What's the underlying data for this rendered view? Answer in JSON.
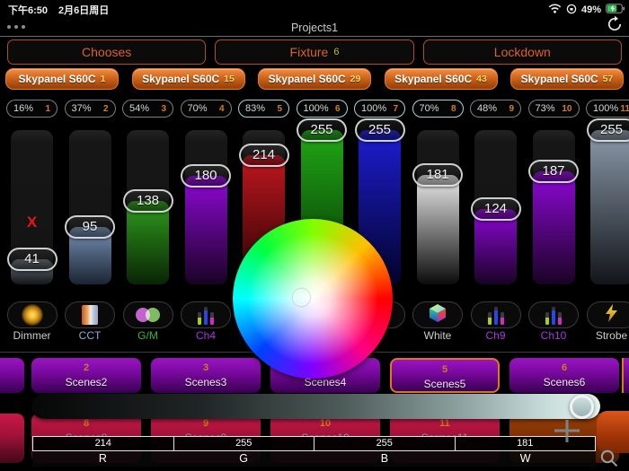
{
  "status_bar": {
    "time": "下午6:50",
    "date": "2月6日周日",
    "battery": "49%"
  },
  "nav": {
    "title": "Projects1"
  },
  "icons": [
    "page-dots",
    "wifi",
    "orientation-lock",
    "battery-charging",
    "refresh",
    "plus",
    "magnifier"
  ],
  "toolbar": {
    "buttons": [
      {
        "label": "Chooses",
        "badge": ""
      },
      {
        "label": "Fixture",
        "badge": "6"
      },
      {
        "label": "Lockdown",
        "badge": ""
      }
    ]
  },
  "fixture_tabs": [
    {
      "name": "Skypanel S60C",
      "num": "1"
    },
    {
      "name": "Skypanel S60C",
      "num": "15"
    },
    {
      "name": "Skypanel S60C",
      "num": "29"
    },
    {
      "name": "Skypanel S60C",
      "num": "43"
    },
    {
      "name": "Skypanel S60C",
      "num": "57"
    }
  ],
  "channels": [
    {
      "percent": "16%",
      "num": "1",
      "value": "41",
      "highlighted": false,
      "label": "Dimmer",
      "label_color": "#cccccc",
      "icon": "dimmer",
      "fill_top": "#68727c",
      "fill_bottom": "#14171a",
      "x_mark": true
    },
    {
      "percent": "37%",
      "num": "2",
      "value": "95",
      "highlighted": false,
      "label": "CCT",
      "label_color": "#8fadd6",
      "icon": "cct",
      "fill_top": "#7792b6",
      "fill_bottom": "#1b2433",
      "x_mark": false
    },
    {
      "percent": "54%",
      "num": "3",
      "value": "138",
      "highlighted": false,
      "label": "G/M",
      "label_color": "#37b837",
      "icon": "gm",
      "fill_top": "#2f9c1e",
      "fill_bottom": "#0a2406",
      "x_mark": false
    },
    {
      "percent": "70%",
      "num": "4",
      "value": "180",
      "highlighted": false,
      "label": "Ch4",
      "label_color": "#aa35e0",
      "icon": "bars",
      "fill_top": "#9008d8",
      "fill_bottom": "#190324",
      "x_mark": false
    },
    {
      "percent": "83%",
      "num": "5",
      "value": "214",
      "highlighted": true,
      "label": "",
      "label_color": "",
      "icon": "none",
      "fill_top": "#c0161f",
      "fill_bottom": "#260404",
      "x_mark": false
    },
    {
      "percent": "100%",
      "num": "6",
      "value": "255",
      "highlighted": true,
      "label": "",
      "label_color": "",
      "icon": "none",
      "fill_top": "#20a816",
      "fill_bottom": "#063003",
      "x_mark": false
    },
    {
      "percent": "100%",
      "num": "7",
      "value": "255",
      "highlighted": true,
      "label": "",
      "label_color": "",
      "icon": "none",
      "fill_top": "#1d1dd2",
      "fill_bottom": "#03032c",
      "x_mark": false
    },
    {
      "percent": "70%",
      "num": "8",
      "value": "181",
      "highlighted": true,
      "label": "White",
      "label_color": "#cccccc",
      "icon": "cube",
      "fill_top": "#ececec",
      "fill_bottom": "#0b0b0b",
      "x_mark": false
    },
    {
      "percent": "48%",
      "num": "9",
      "value": "124",
      "highlighted": false,
      "label": "Ch9",
      "label_color": "#aa35e0",
      "icon": "bars",
      "fill_top": "#9008d8",
      "fill_bottom": "#190324",
      "x_mark": false
    },
    {
      "percent": "73%",
      "num": "10",
      "value": "187",
      "highlighted": false,
      "label": "Ch10",
      "label_color": "#aa35e0",
      "icon": "bars",
      "fill_top": "#9008d8",
      "fill_bottom": "#190324",
      "x_mark": false
    },
    {
      "percent": "100%",
      "num": "11",
      "value": "255",
      "highlighted": false,
      "label": "Strobe",
      "label_color": "#cccccc",
      "icon": "bolt",
      "fill_top": "#8c9aaa",
      "fill_bottom": "#12151a",
      "x_mark": false
    }
  ],
  "scenes_row1": {
    "items": [
      {
        "num": "2",
        "label": "Scenes2",
        "selected": false
      },
      {
        "num": "3",
        "label": "Scenes3",
        "selected": false
      },
      {
        "num": "4",
        "label": "Scenes4",
        "selected": false
      },
      {
        "num": "5",
        "label": "Scenes5",
        "selected": true
      },
      {
        "num": "6",
        "label": "Scenes6",
        "selected": false
      }
    ]
  },
  "scenes_row2": {
    "items": [
      {
        "num": "8",
        "label": "Scenes8",
        "rust": false
      },
      {
        "num": "9",
        "label": "Scenes9",
        "rust": false
      },
      {
        "num": "10",
        "label": "Scenes10",
        "rust": false
      },
      {
        "num": "11",
        "label": "Scenes11",
        "rust": false
      },
      {
        "num": "",
        "label": "",
        "rust": true
      }
    ]
  },
  "rgbw_table": {
    "cells": [
      {
        "value": "214",
        "label": "R"
      },
      {
        "value": "255",
        "label": "G"
      },
      {
        "value": "255",
        "label": "B"
      },
      {
        "value": "181",
        "label": "W"
      }
    ]
  },
  "colors": {
    "accent_orange": "#dd6125",
    "pill_highlight": "#9fd6d6",
    "scene_selected_border": "#e07818"
  }
}
